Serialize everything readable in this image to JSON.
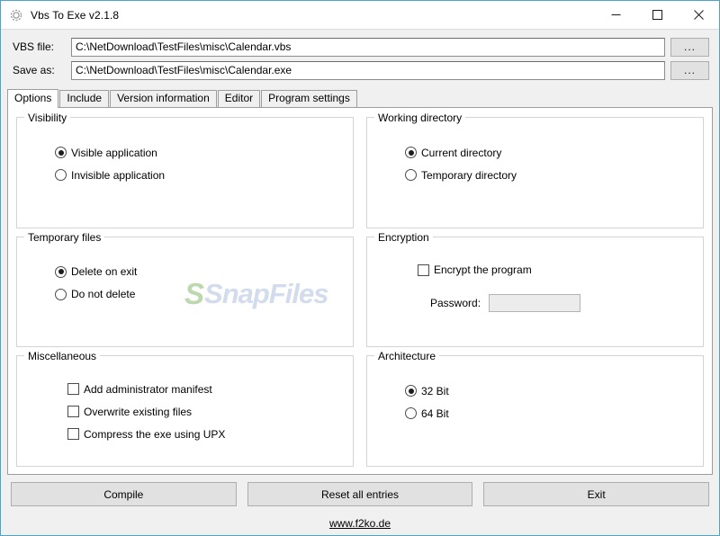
{
  "window": {
    "title": "Vbs To Exe v2.1.8",
    "icon": "gear-icon",
    "minimize_label": "—",
    "maximize_label": "□",
    "close_label": "✕",
    "border_color": "#4ea3c8"
  },
  "fields": {
    "vbs": {
      "label": "VBS file:",
      "value": "C:\\NetDownload\\TestFiles\\misc\\Calendar.vbs",
      "placeholder": "",
      "browse_label": "..."
    },
    "save": {
      "label": "Save as:",
      "value": "C:\\NetDownload\\TestFiles\\misc\\Calendar.exe",
      "placeholder": "",
      "browse_label": "..."
    }
  },
  "tabs": [
    {
      "label": "Options",
      "active": true
    },
    {
      "label": "Include",
      "active": false
    },
    {
      "label": "Version information",
      "active": false
    },
    {
      "label": "Editor",
      "active": false
    },
    {
      "label": "Program settings",
      "active": false
    }
  ],
  "groups": {
    "visibility": {
      "title": "Visibility",
      "options": [
        {
          "label": "Visible application",
          "checked": true
        },
        {
          "label": "Invisible application",
          "checked": false
        }
      ]
    },
    "temporary_files": {
      "title": "Temporary files",
      "options": [
        {
          "label": "Delete on exit",
          "checked": true
        },
        {
          "label": "Do not delete",
          "checked": false
        }
      ]
    },
    "miscellaneous": {
      "title": "Miscellaneous",
      "options": [
        {
          "label": "Add administrator manifest",
          "checked": false
        },
        {
          "label": "Overwrite existing files",
          "checked": false
        },
        {
          "label": "Compress the exe using UPX",
          "checked": false
        }
      ]
    },
    "working_directory": {
      "title": "Working directory",
      "options": [
        {
          "label": "Current directory",
          "checked": true
        },
        {
          "label": "Temporary directory",
          "checked": false
        }
      ]
    },
    "encryption": {
      "title": "Encryption",
      "options": [
        {
          "label": "Encrypt the program",
          "checked": false
        }
      ],
      "password_label": "Password:",
      "password_value": "",
      "password_placeholder": "",
      "password_enabled": false
    },
    "architecture": {
      "title": "Architecture",
      "options": [
        {
          "label": "32 Bit",
          "checked": true
        },
        {
          "label": "64 Bit",
          "checked": false
        }
      ]
    }
  },
  "watermark": {
    "logo": "S",
    "text": "SnapFiles"
  },
  "buttons": [
    {
      "label": "Compile"
    },
    {
      "label": "Reset all entries"
    },
    {
      "label": "Exit"
    }
  ],
  "footer": {
    "link": "www.f2ko.de"
  }
}
